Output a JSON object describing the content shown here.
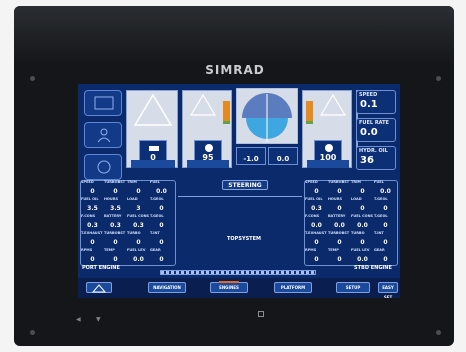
{
  "device": {
    "brand": "SIMRAD"
  },
  "engines": [
    {
      "id": "port",
      "value": "0"
    },
    {
      "id": "port-trim",
      "value": "95"
    },
    {
      "id": "stbd-trim",
      "value": "100"
    },
    {
      "id": "stbd",
      "value": "0"
    }
  ],
  "rudders": [
    {
      "value": "-1.0"
    },
    {
      "value": "0.0"
    }
  ],
  "info": {
    "speed": {
      "label": "SPEED",
      "value": "0.1"
    },
    "fuel_rate": {
      "label": "FUEL RATE",
      "value": "0.0"
    },
    "hydr_oil": {
      "label": "HYDR. OIL",
      "value": "36"
    }
  },
  "steering": {
    "label": "STEERING"
  },
  "port_engine": {
    "label": "PORT ENGINE",
    "cells": [
      {
        "label": "SPEED",
        "value": "0"
      },
      {
        "label": "TURBOBST",
        "value": "0"
      },
      {
        "label": "TRIM",
        "value": "0"
      },
      {
        "label": "FUEL",
        "value": "0.0"
      },
      {
        "label": "FUEL OIL",
        "value": "3.5"
      },
      {
        "label": "HOURS",
        "value": "3.5"
      },
      {
        "label": "LOAD",
        "value": "3"
      },
      {
        "label": "T.GEOL",
        "value": "0"
      },
      {
        "label": "F.CONS",
        "value": "0.3"
      },
      {
        "label": "BATTERY",
        "value": "0.3"
      },
      {
        "label": "FUEL CONS",
        "value": "0.3"
      },
      {
        "label": "T.GEOL",
        "value": "0"
      },
      {
        "label": "T.EXHAUST",
        "value": "0"
      },
      {
        "label": "TURBOBST",
        "value": "0"
      },
      {
        "label": "TURBO",
        "value": "0"
      },
      {
        "label": "T.INT",
        "value": "0"
      },
      {
        "label": "RPMS",
        "value": "0"
      },
      {
        "label": "TEMP",
        "value": "0"
      },
      {
        "label": "FUEL LEV",
        "value": "0.0"
      },
      {
        "label": "GEAR",
        "value": "0"
      }
    ]
  },
  "stbd_engine": {
    "label": "STBD ENGINE",
    "cells": [
      {
        "label": "SPEED",
        "value": "0"
      },
      {
        "label": "TURBOBST",
        "value": "0"
      },
      {
        "label": "TRIM",
        "value": "0"
      },
      {
        "label": "FUEL",
        "value": "0.0"
      },
      {
        "label": "FUEL OIL",
        "value": "0.3"
      },
      {
        "label": "HOURS",
        "value": "0"
      },
      {
        "label": "LOAD",
        "value": "0"
      },
      {
        "label": "T.GEOL",
        "value": "0"
      },
      {
        "label": "F.CONS",
        "value": "0.0"
      },
      {
        "label": "BATTERY",
        "value": "0.0"
      },
      {
        "label": "FUEL CONS",
        "value": "0.0"
      },
      {
        "label": "T.GEOL",
        "value": "0"
      },
      {
        "label": "T.EXHAUST",
        "value": "0"
      },
      {
        "label": "TURBOBST",
        "value": "0"
      },
      {
        "label": "TURBO",
        "value": "0"
      },
      {
        "label": "T.INT",
        "value": "0"
      },
      {
        "label": "RPMS",
        "value": "0"
      },
      {
        "label": "TEMP",
        "value": "0"
      },
      {
        "label": "FUEL LEV",
        "value": "0.0"
      },
      {
        "label": "GEAR",
        "value": "0"
      }
    ]
  },
  "topsystem": {
    "label": "TOPSYSTEM"
  },
  "menu": [
    {
      "label": "NAVIGATION"
    },
    {
      "label": "ENGINES"
    },
    {
      "label": "PLATFORM"
    },
    {
      "label": "SETUP"
    },
    {
      "label": "EASY SET"
    }
  ],
  "colors": {
    "screen": "#0b2a6b",
    "accent": "#e4681e",
    "gauge_fill": "#e48a1e"
  }
}
